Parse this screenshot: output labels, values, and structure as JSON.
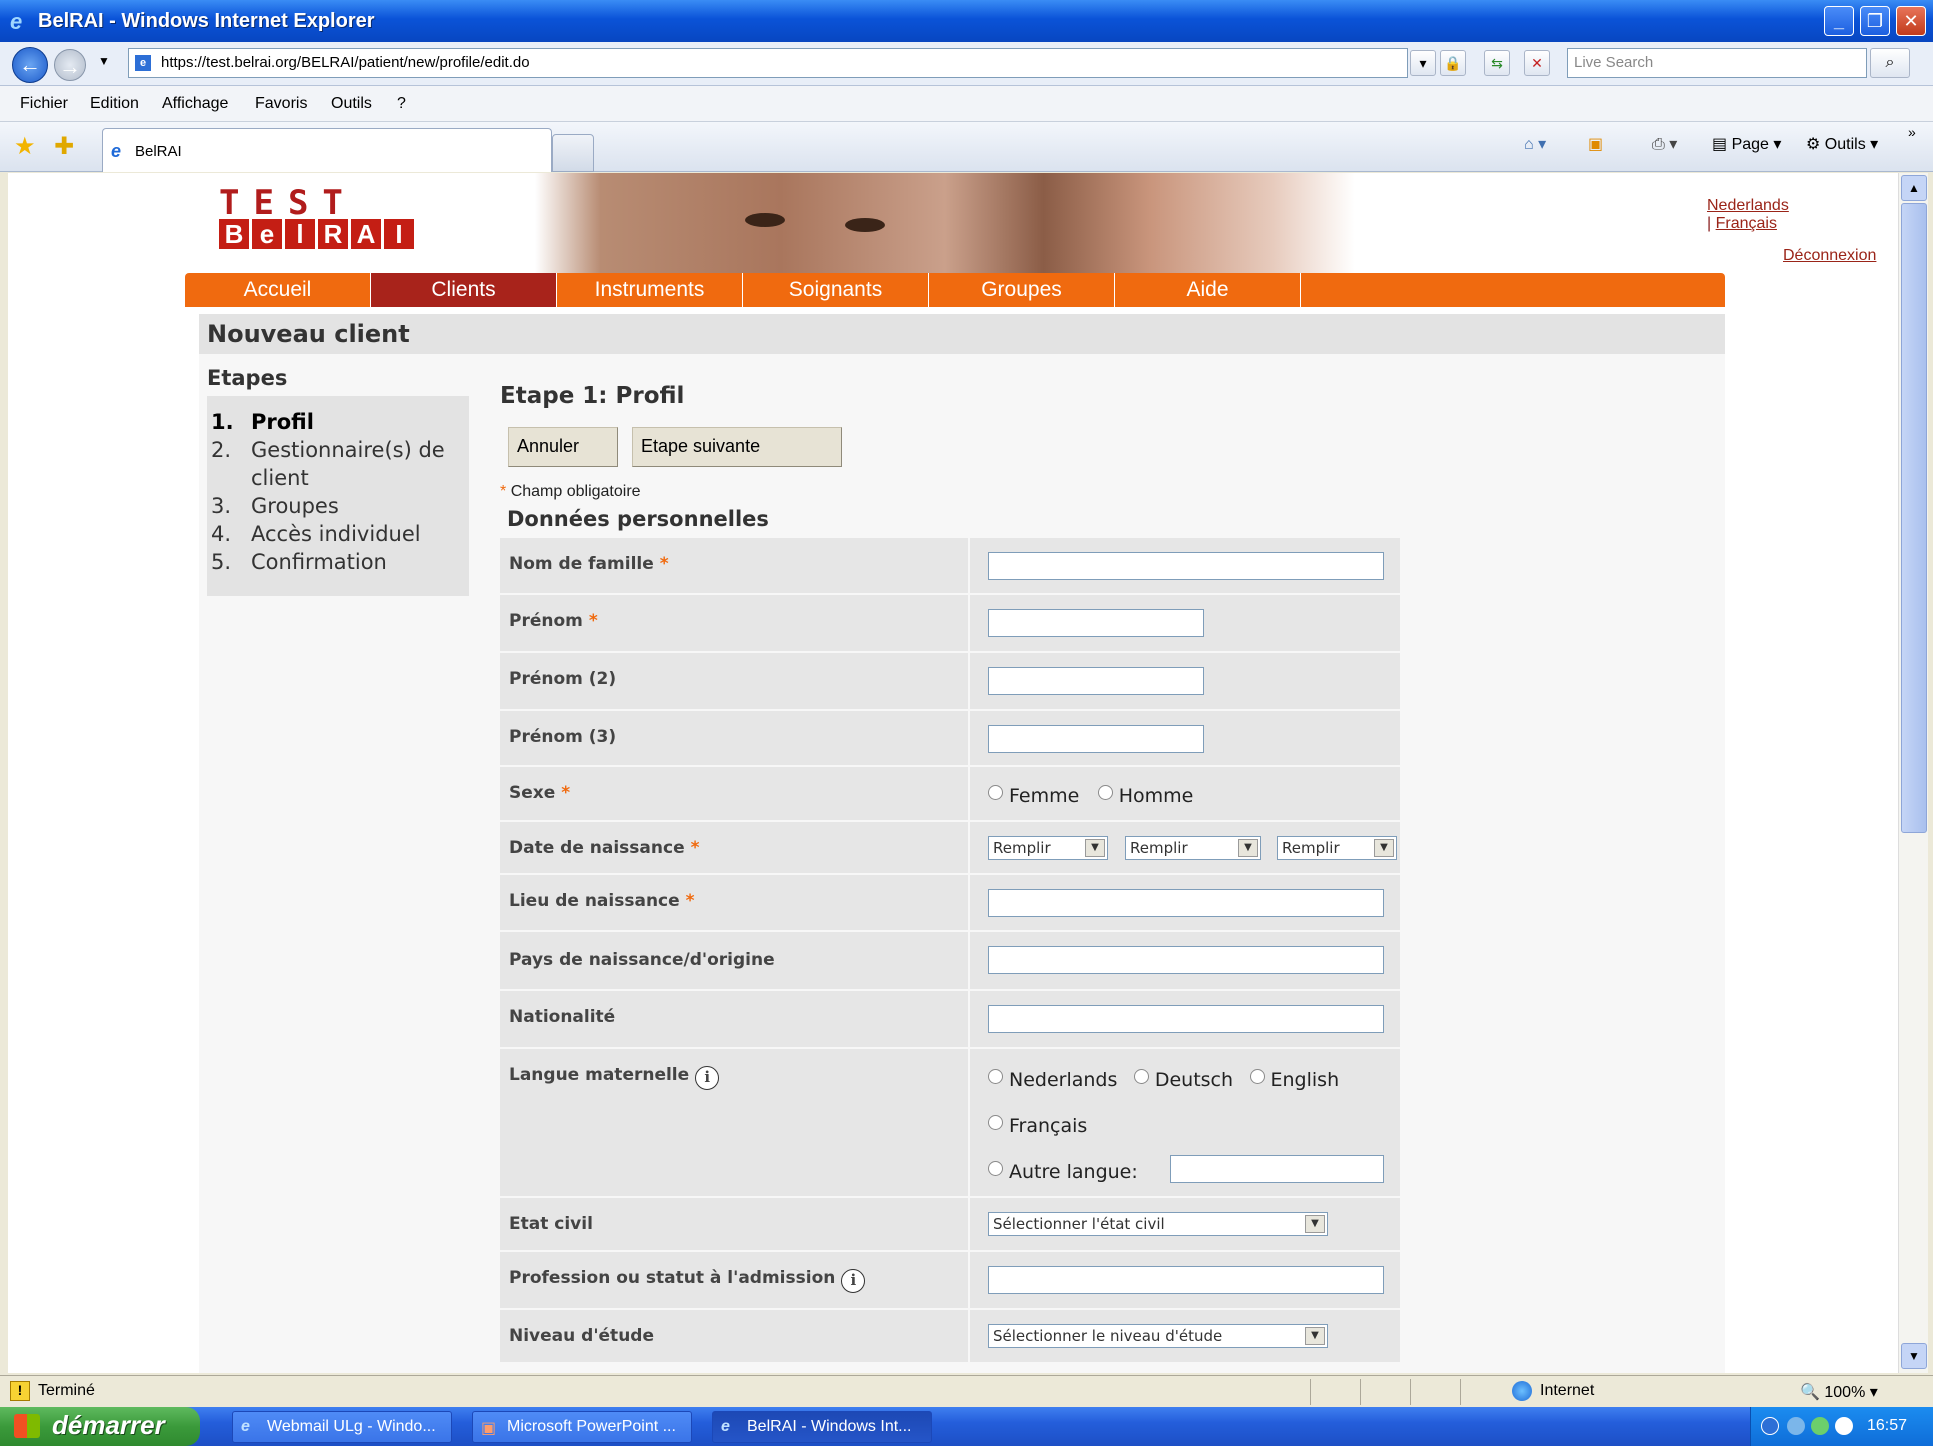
{
  "window": {
    "title": "BelRAI - Windows Internet Explorer",
    "url": "https://test.belrai.org/BELRAI/patient/new/profile/edit.do",
    "search_placeholder": "Live Search",
    "menu": [
      "Fichier",
      "Edition",
      "Affichage",
      "Favoris",
      "Outils",
      "?"
    ],
    "tab_label": "BelRAI",
    "cmd_page": "Page",
    "cmd_tools": "Outils"
  },
  "site": {
    "logo_top": "TEST",
    "logo_letters": [
      "B",
      "e",
      "l",
      "R",
      "A",
      "I"
    ],
    "lang_nl": "Nederlands",
    "lang_sep": "|",
    "lang_fr": "Français",
    "logout": "Déconnexion",
    "nav": [
      "Accueil",
      "Clients",
      "Instruments",
      "Soignants",
      "Groupes",
      "Aide"
    ],
    "nav_active": "Clients"
  },
  "page": {
    "title": "Nouveau client",
    "steps_title": "Etapes",
    "steps": [
      {
        "num": "1.",
        "label": "Profil",
        "current": true
      },
      {
        "num": "2.",
        "label": "Gestionnaire(s) de client",
        "current": false
      },
      {
        "num": "3.",
        "label": "Groupes",
        "current": false
      },
      {
        "num": "4.",
        "label": "Accès individuel",
        "current": false
      },
      {
        "num": "5.",
        "label": "Confirmation",
        "current": false
      }
    ],
    "step_title": "Etape 1: Profil",
    "cancel_button": "Annuler",
    "next_button": "Etape suivante",
    "required_star": "*",
    "required_note": "Champ obligatoire",
    "section_title": "Données personnelles"
  },
  "form": {
    "nom_famille": {
      "label": "Nom de famille",
      "required": "*",
      "value": ""
    },
    "prenom": {
      "label": "Prénom",
      "required": "*",
      "value": ""
    },
    "prenom2": {
      "label": "Prénom (2)",
      "value": ""
    },
    "prenom3": {
      "label": "Prénom (3)",
      "value": ""
    },
    "sexe": {
      "label": "Sexe",
      "required": "*",
      "options": [
        "Femme",
        "Homme"
      ]
    },
    "naissance": {
      "label": "Date de naissance",
      "required": "*",
      "day": "Remplir",
      "month": "Remplir",
      "year": "Remplir"
    },
    "lieu": {
      "label": "Lieu de naissance",
      "required": "*",
      "value": ""
    },
    "pays": {
      "label": "Pays de naissance/d'origine",
      "value": ""
    },
    "nationalite": {
      "label": "Nationalité",
      "value": ""
    },
    "langue": {
      "label": "Langue maternelle",
      "info": "i",
      "options": [
        "Nederlands",
        "Deutsch",
        "English",
        "Français"
      ],
      "other": "Autre langue:"
    },
    "etat_civil": {
      "label": "Etat civil",
      "selected": "Sélectionner l'état civil"
    },
    "profession": {
      "label": "Profession ou statut à l'admission",
      "info": "i",
      "value": ""
    },
    "etude": {
      "label": "Niveau d'étude",
      "selected": "Sélectionner le niveau d'étude"
    }
  },
  "status": {
    "text": "Terminé",
    "zone": "Internet",
    "zoom": "100%"
  },
  "taskbar": {
    "start": "démarrer",
    "tasks": [
      "Webmail ULg - Windo...",
      "Microsoft PowerPoint ...",
      "BelRAI - Windows Int..."
    ],
    "clock": "16:57"
  }
}
